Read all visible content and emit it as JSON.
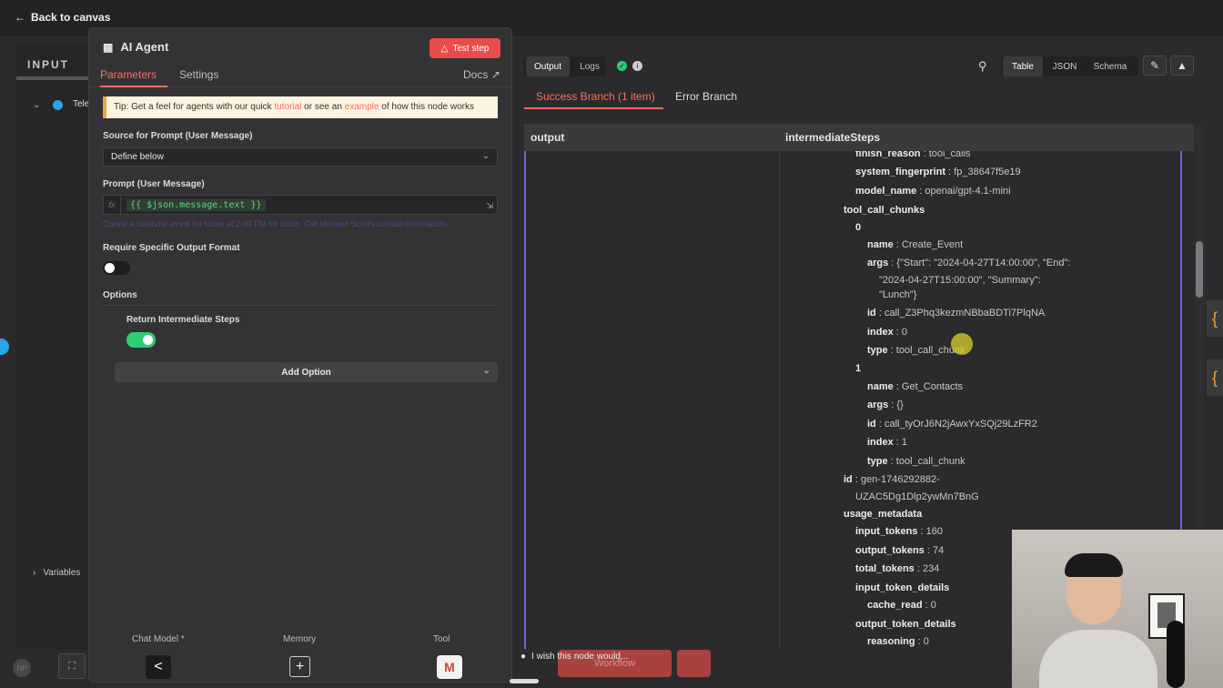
{
  "nav": {
    "back_label": "Back to canvas"
  },
  "input_panel": {
    "title": "INPUT",
    "row1": "Tele",
    "variables_label": "Variables"
  },
  "node": {
    "title": "AI Agent",
    "test_step": "Test step",
    "tabs": [
      "Parameters",
      "Settings"
    ],
    "docs": "Docs",
    "tip": {
      "pre": "Tip: Get a feel for agents with our quick ",
      "link1": "tutorial",
      "mid": " or see an ",
      "link2": "example",
      "post": " of how this node works"
    },
    "source_label": "Source for Prompt (User Message)",
    "source_value": "Define below",
    "prompt_label": "Prompt (User Message)",
    "prompt_fx": "fx",
    "prompt_value": "{{ $json.message.text }}",
    "prompt_hint": "Create a calendar event for today at 2:00 PM for lunch. Get Michael Scott's contact information.",
    "output_format_label": "Require Specific Output Format",
    "output_format_enabled": false,
    "options_label": "Options",
    "return_steps_label": "Return Intermediate Steps",
    "return_steps_enabled": true,
    "add_option": "Add Option",
    "bottom": {
      "chat_model": "Chat Model *",
      "memory": "Memory",
      "tool": "Tool"
    }
  },
  "output": {
    "tabs": [
      "Output",
      "Logs"
    ],
    "views": [
      "Table",
      "JSON",
      "Schema"
    ],
    "branches": [
      "Success Branch (1 item)",
      "Error Branch"
    ],
    "columns": [
      "output",
      "intermediateSteps"
    ],
    "rows": [
      {
        "k": "finish_reason",
        "v": "tool_calls",
        "indent": 1
      },
      {
        "k": "system_fingerprint",
        "v": "fp_38647f5e19",
        "indent": 1
      },
      {
        "k": "model_name",
        "v": "openai/gpt-4.1-mini",
        "indent": 1
      },
      {
        "k": "tool_call_chunks",
        "v": "",
        "indent": 0
      },
      {
        "k": "0",
        "v": "",
        "indent": 1
      },
      {
        "k": "name",
        "v": "Create_Event",
        "indent": 2
      },
      {
        "k": "args",
        "v": "{\"Start\": \"2024-04-27T14:00:00\", \"End\":",
        "indent": 2
      },
      {
        "k": "",
        "v": "\"2024-04-27T15:00:00\", \"Summary\":",
        "indent": 3
      },
      {
        "k": "",
        "v": "\"Lunch\"}",
        "indent": 3
      },
      {
        "k": "id",
        "v": "call_Z3Phq3kezmNBbaBDTi7PlqNA",
        "indent": 2
      },
      {
        "k": "index",
        "v": "0",
        "indent": 2
      },
      {
        "k": "type",
        "v": "tool_call_chunk",
        "indent": 2
      },
      {
        "k": "1",
        "v": "",
        "indent": 1
      },
      {
        "k": "name",
        "v": "Get_Contacts",
        "indent": 2
      },
      {
        "k": "args",
        "v": "{}",
        "indent": 2
      },
      {
        "k": "id",
        "v": "call_tyOrJ6N2jAwxYxSQj29LzFR2",
        "indent": 2
      },
      {
        "k": "index",
        "v": "1",
        "indent": 2
      },
      {
        "k": "type",
        "v": "tool_call_chunk",
        "indent": 2
      },
      {
        "k": "id",
        "v": "gen-1746292882-",
        "indent": 0
      },
      {
        "k": "",
        "v": "UZAC5Dg1Dlp2ywMn7BnG",
        "indent": 1
      },
      {
        "k": "usage_metadata",
        "v": "",
        "indent": 0
      },
      {
        "k": "input_tokens",
        "v": "160",
        "indent": 1
      },
      {
        "k": "output_tokens",
        "v": "74",
        "indent": 1
      },
      {
        "k": "total_tokens",
        "v": "234",
        "indent": 1
      },
      {
        "k": "input_token_details",
        "v": "",
        "indent": 1
      },
      {
        "k": "cache_read",
        "v": "0",
        "indent": 2
      },
      {
        "k": "output_token_details",
        "v": "",
        "indent": 1
      },
      {
        "k": "reasoning",
        "v": "0",
        "indent": 2
      }
    ]
  },
  "footer": {
    "wish": "I wish this node would...",
    "ghost": "Workflow"
  },
  "colors": {
    "accent": "#ff6d5a",
    "success": "#2ecc71",
    "toggle_on": "#2ecc71",
    "branch_border": "#6d5ed6"
  }
}
